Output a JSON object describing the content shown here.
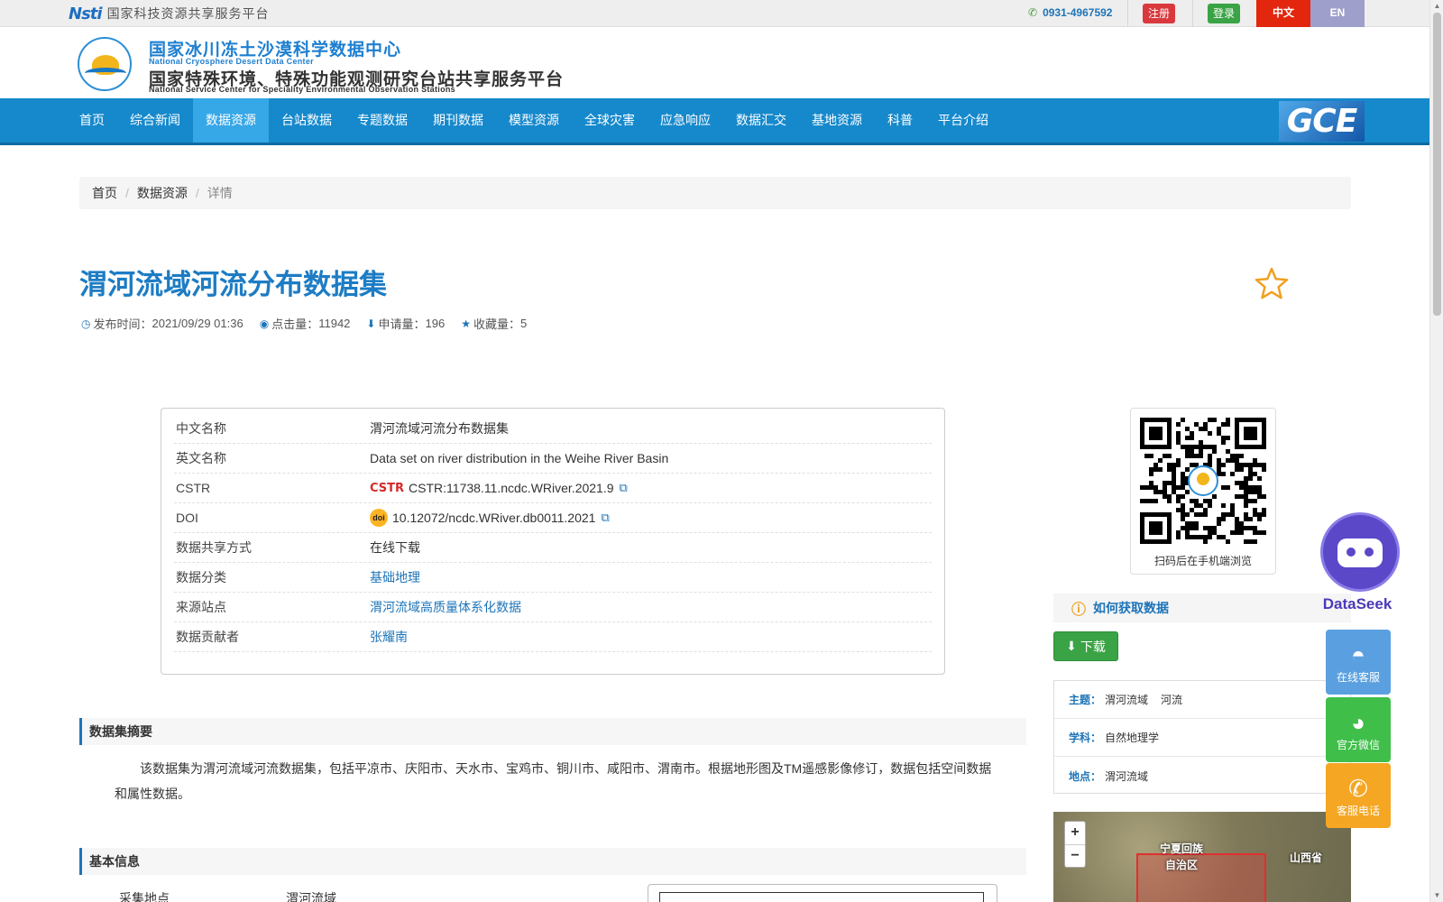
{
  "topbar": {
    "nsti_mark": "Nsti",
    "platform_name": "国家科技资源共享服务平台",
    "phone": "0931-4967592",
    "register": "注册",
    "login": "登录",
    "lang_zh": "中文",
    "lang_en": "EN"
  },
  "header": {
    "title_zh": "国家冰川冻土沙漠科学数据中心",
    "title_en": "National Cryosphere Desert Data Center",
    "title2_zh": "国家特殊环境、特殊功能观测研究台站共享服务平台",
    "title2_en": "National Service Center for Speciality Environmental Observation Stations"
  },
  "nav": {
    "items": [
      "首页",
      "综合新闻",
      "数据资源",
      "台站数据",
      "专题数据",
      "期刊数据",
      "模型资源",
      "全球灾害",
      "应急响应",
      "数据汇交",
      "基地资源",
      "科普",
      "平台介绍"
    ],
    "active": "数据资源",
    "logo": "GCE"
  },
  "breadcrumb": {
    "home": "首页",
    "section": "数据资源",
    "current": "详情",
    "sep": "/"
  },
  "dataset": {
    "title": "渭河流域河流分布数据集",
    "publish_label": "发布时间：",
    "publish_time": "2021/09/29 01:36",
    "clicks_label": "点击量：",
    "clicks": "11942",
    "applies_label": "申请量：",
    "applies": "196",
    "favorites_label": "收藏量：",
    "favorites": "5"
  },
  "info": {
    "rows": [
      {
        "key": "中文名称",
        "value": "渭河流域河流分布数据集"
      },
      {
        "key": "英文名称",
        "value": "Data set on river distribution in the Weihe River Basin"
      },
      {
        "key": "CSTR",
        "value": "CSTR:11738.11.ncdc.WRiver.2021.9"
      },
      {
        "key": "DOI",
        "value": "10.12072/ncdc.WRiver.db0011.2021"
      },
      {
        "key": "数据共享方式",
        "value": "在线下载"
      },
      {
        "key": "数据分类",
        "value": "基础地理"
      },
      {
        "key": "来源站点",
        "value": "渭河流域高质量体系化数据"
      },
      {
        "key": "数据贡献者",
        "value": "张耀南"
      }
    ],
    "cstr_badge": "CSTR",
    "doi_badge": "doi"
  },
  "sections": {
    "abstract_title": "数据集摘要",
    "abstract_text": "该数据集为渭河流域河流数据集，包括平凉市、庆阳市、天水市、宝鸡市、铜川市、咸阳市、渭南市。根据地形图及TM遥感影像修订，数据包括空间数据和属性数据。",
    "basic_title": "基本信息",
    "basic_key": "采集地点",
    "basic_value": "渭河流域"
  },
  "sidebar": {
    "qr_caption": "扫码后在手机端浏览",
    "howto": "如何获取数据",
    "download": "下载",
    "tags": [
      {
        "key": "主题：",
        "values": [
          "渭河流域",
          "河流"
        ]
      },
      {
        "key": "学科：",
        "values": [
          "自然地理学"
        ]
      },
      {
        "key": "地点：",
        "values": [
          "渭河流域"
        ]
      }
    ],
    "map_labels": {
      "region1_a": "宁夏回族",
      "region1_b": "自治区",
      "region2": "山西省"
    },
    "zoom_in": "+",
    "zoom_out": "−"
  },
  "floating": {
    "dataseek": "DataSeek",
    "online_service": "在线客服",
    "wechat": "官方微信",
    "phone": "客服电话"
  },
  "colors": {
    "primary": "#1689cc",
    "title": "#1d7cc4",
    "green": "#3aa345",
    "red": "#d9393d",
    "star": "#f0a020"
  }
}
